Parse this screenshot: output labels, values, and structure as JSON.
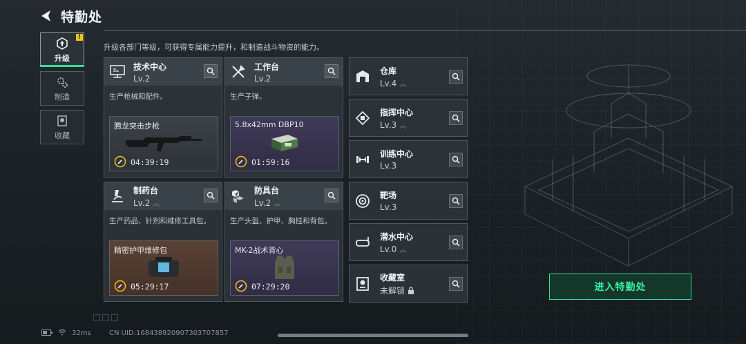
{
  "header": {
    "title": "特勤处"
  },
  "nav": [
    {
      "label": "升级",
      "active": true,
      "alert": "!"
    },
    {
      "label": "制造",
      "active": false
    },
    {
      "label": "收藏",
      "active": false
    }
  ],
  "description": "升级各部门等级，可获得专属能力提升，和制造战斗物资的能力。",
  "cards": [
    {
      "name": "技术中心",
      "level": "Lv.2",
      "desc": "生产枪械和配件。",
      "product": "腾龙突击步枪",
      "time": "04:39:19"
    },
    {
      "name": "工作台",
      "level": "Lv.2",
      "desc": "生产子弹。",
      "product": "5.8x42mm DBP10",
      "time": "01:59:16"
    },
    {
      "name": "制药台",
      "level": "Lv.2",
      "desc": "生产药品、针剂和维修工具包。",
      "product": "精密护甲维修包",
      "time": "05:29:17"
    },
    {
      "name": "防具台",
      "level": "Lv.2",
      "desc": "生产头盔、护甲、胸挂和背包。",
      "product": "MK-2战术背心",
      "time": "07:29:20"
    }
  ],
  "small_cards": [
    {
      "name": "仓库",
      "level": "Lv.4",
      "upgradable": true
    },
    {
      "name": "指挥中心",
      "level": "Lv.3",
      "upgradable": true
    },
    {
      "name": "训练中心",
      "level": "Lv.3",
      "upgradable": false
    },
    {
      "name": "靶场",
      "level": "Lv.3",
      "upgradable": false
    },
    {
      "name": "潜水中心",
      "level": "Lv.0",
      "upgradable": true
    },
    {
      "name": "收藏室",
      "level": "未解锁",
      "upgradable": false,
      "locked": true
    }
  ],
  "enter_button": "进入特勤处",
  "status": {
    "ping": "32ms",
    "uid": "CN UID:168438920907303707857"
  },
  "colors": {
    "accent": "#36e39b",
    "alert": "#f2c21a"
  }
}
